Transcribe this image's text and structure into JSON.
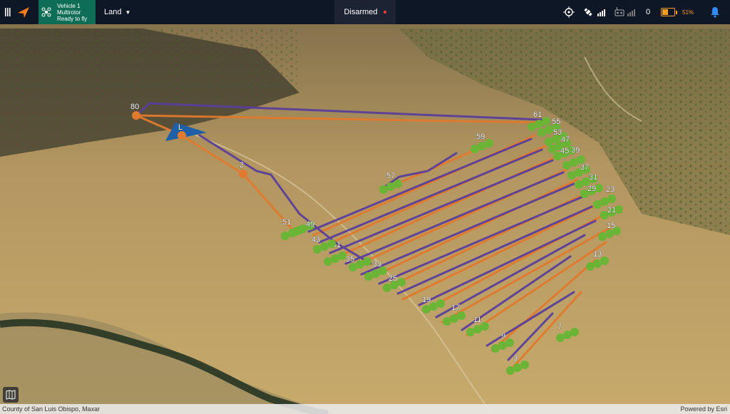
{
  "header": {
    "vehicle_line1": "Vehicle 1",
    "vehicle_line2": "Multirotor",
    "vehicle_line3": "Ready to fly",
    "flight_mode": "Land",
    "arm_status": "Disarmed",
    "telemetry_value": "0",
    "battery_percent": "51%",
    "battery_level": 0.51,
    "status_dot_color": "#ff3b3b",
    "vehicle_color": "#0d6e55",
    "accent_color": "#ff9d1f",
    "bell_color": "#2f8cff"
  },
  "footer": {
    "attribution": "County of San Luis Obispo, Maxar",
    "powered_by": "Powered by Esri"
  },
  "map": {
    "launch_label": "L",
    "takeoff_label": "2",
    "rtl_label": "80",
    "waypoint_labels": [
      "3",
      "9",
      "11",
      "17",
      "19",
      "25",
      "33",
      "35",
      "41",
      "43",
      "49",
      "51",
      "57",
      "59",
      "61",
      "55",
      "53",
      "47",
      "45",
      "39",
      "37",
      "31",
      "29",
      "23",
      "21",
      "15",
      "13",
      "7"
    ],
    "path_colors": {
      "planned": "#e07a2e",
      "flown": "#5a3f9a"
    },
    "waypoint_color": "#6ab536",
    "icons": [
      "menu-icon",
      "qgc-logo-icon",
      "drone-icon",
      "caret-down-icon",
      "gps-icon",
      "satellite-icon",
      "rc-icon",
      "signal-icon",
      "battery-icon",
      "bell-icon",
      "map-icon"
    ]
  }
}
